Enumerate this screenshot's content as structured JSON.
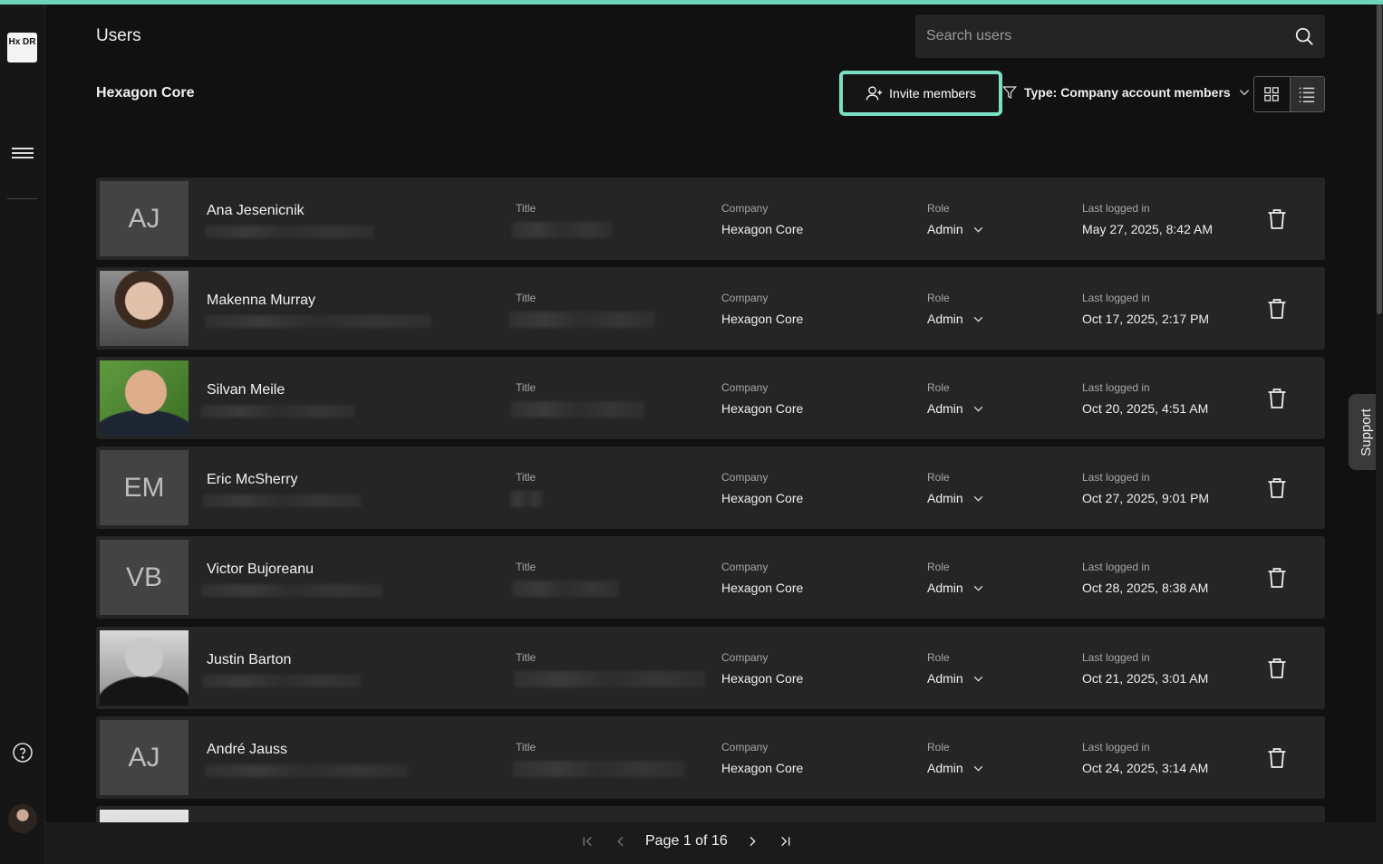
{
  "app": {
    "logo_text": "Hx DR"
  },
  "header": {
    "title": "Users",
    "org_name": "Hexagon Core"
  },
  "search": {
    "placeholder": "Search users"
  },
  "toolbar": {
    "invite_label": "Invite members",
    "filter_label": "Type: Company account members"
  },
  "columns": {
    "title": "Title",
    "company": "Company",
    "role": "Role",
    "last_logged_in": "Last logged in"
  },
  "users": [
    {
      "name": "Ana Jesenicnik",
      "initials": "AJ",
      "photo": false,
      "company": "Hexagon Core",
      "role": "Admin",
      "last_logged_in": "May 27, 2025, 8:42 AM"
    },
    {
      "name": "Makenna Murray",
      "initials": "",
      "photo": true,
      "company": "Hexagon Core",
      "role": "Admin",
      "last_logged_in": "Oct 17, 2025, 2:17 PM"
    },
    {
      "name": "Silvan Meile",
      "initials": "",
      "photo": true,
      "company": "Hexagon Core",
      "role": "Admin",
      "last_logged_in": "Oct 20, 2025, 4:51 AM"
    },
    {
      "name": "Eric McSherry",
      "initials": "EM",
      "photo": false,
      "company": "Hexagon Core",
      "role": "Admin",
      "last_logged_in": "Oct 27, 2025, 9:01 PM"
    },
    {
      "name": "Victor Bujoreanu",
      "initials": "VB",
      "photo": false,
      "company": "Hexagon Core",
      "role": "Admin",
      "last_logged_in": "Oct 28, 2025, 8:38 AM"
    },
    {
      "name": "Justin Barton",
      "initials": "",
      "photo": true,
      "company": "Hexagon Core",
      "role": "Admin",
      "last_logged_in": "Oct 21, 2025, 3:01 AM"
    },
    {
      "name": "André Jauss",
      "initials": "AJ",
      "photo": false,
      "company": "Hexagon Core",
      "role": "Admin",
      "last_logged_in": "Oct 24, 2025, 3:14 AM"
    }
  ],
  "pagination": {
    "label": "Page 1 of 16"
  },
  "support": {
    "label": "Support"
  },
  "colors": {
    "accent": "#79e0c4",
    "background": "#111111",
    "row": "#252525"
  }
}
